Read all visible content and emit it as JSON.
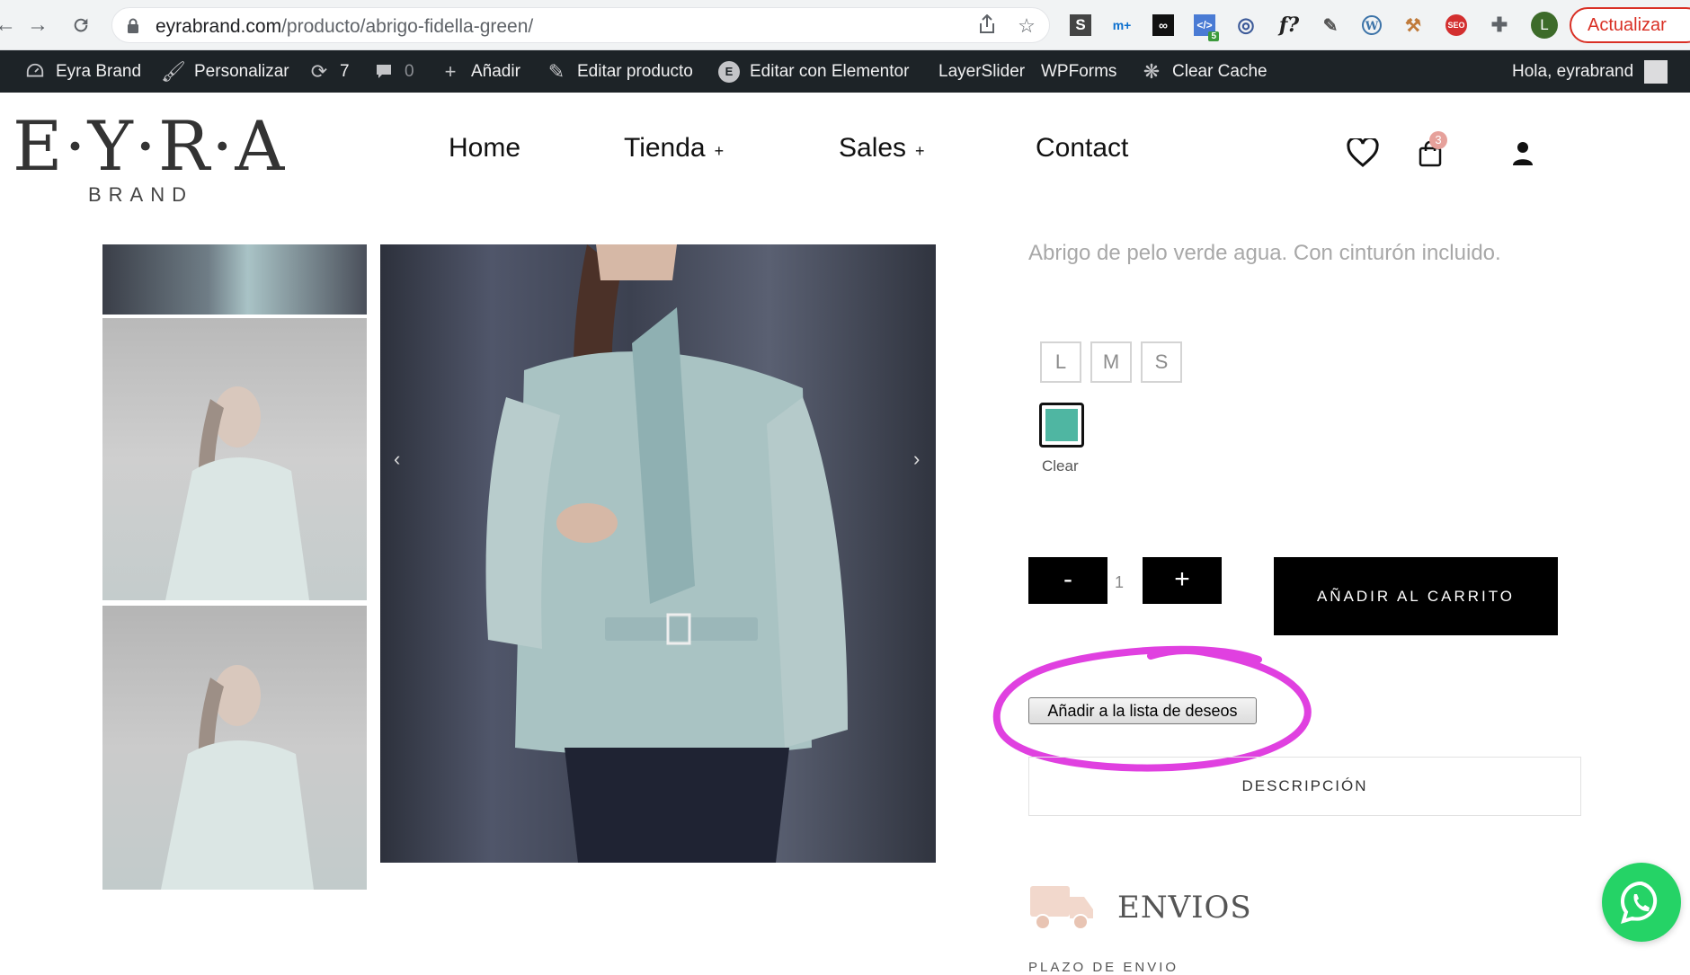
{
  "browser": {
    "url_domain": "eyrabrand.com",
    "url_path": "/producto/abrigo-fidella-green/",
    "update_label": "Actualizar",
    "profile_initial": "L",
    "ext_badge": "5",
    "ext_icons": [
      "s-icon",
      "movistar-icon",
      "glasses-icon",
      "code-icon",
      "target-icon",
      "font-icon",
      "eyedropper-icon",
      "wordpress-icon",
      "hammer-icon",
      "seo-icon",
      "puzzle-icon"
    ]
  },
  "adminbar": {
    "site_name": "Eyra Brand",
    "customize": "Personalizar",
    "updates_count": "7",
    "comments_count": "0",
    "add_new": "Añadir",
    "edit_product": "Editar producto",
    "edit_elementor": "Editar con Elementor",
    "layerslider": "LayerSlider",
    "wpforms": "WPForms",
    "clear_cache": "Clear Cache",
    "greeting": "Hola, eyrabrand"
  },
  "header": {
    "logo_main": "E·Y·R·A",
    "logo_sub": "BRAND",
    "menu": [
      {
        "label": "Home",
        "has_sub": false
      },
      {
        "label": "Tienda",
        "has_sub": true
      },
      {
        "label": "Sales",
        "has_sub": true
      },
      {
        "label": "Contact",
        "has_sub": false
      }
    ],
    "submenu_marker": "+",
    "cart_count": "3"
  },
  "product": {
    "description": "Abrigo de pelo verde agua. Con cinturón incluido.",
    "sizes": [
      "L",
      "M",
      "S"
    ],
    "color_hex": "#4fb6a2",
    "clear_label": "Clear",
    "qty_minus": "-",
    "qty_value": "1",
    "qty_plus": "+",
    "add_to_cart": "AÑADIR AL CARRITO",
    "wishlist": "Añadir a la lista de deseos",
    "description_tab": "DESCRIPCIÓN",
    "shipping_title": "ENVIOS",
    "shipping_subtitle": "PLAZO DE ENVIO"
  },
  "gallery": {
    "prev_arrow": "‹",
    "next_arrow": "›"
  },
  "colors": {
    "accent_highlight": "#e040e0",
    "whatsapp": "#25d366"
  }
}
